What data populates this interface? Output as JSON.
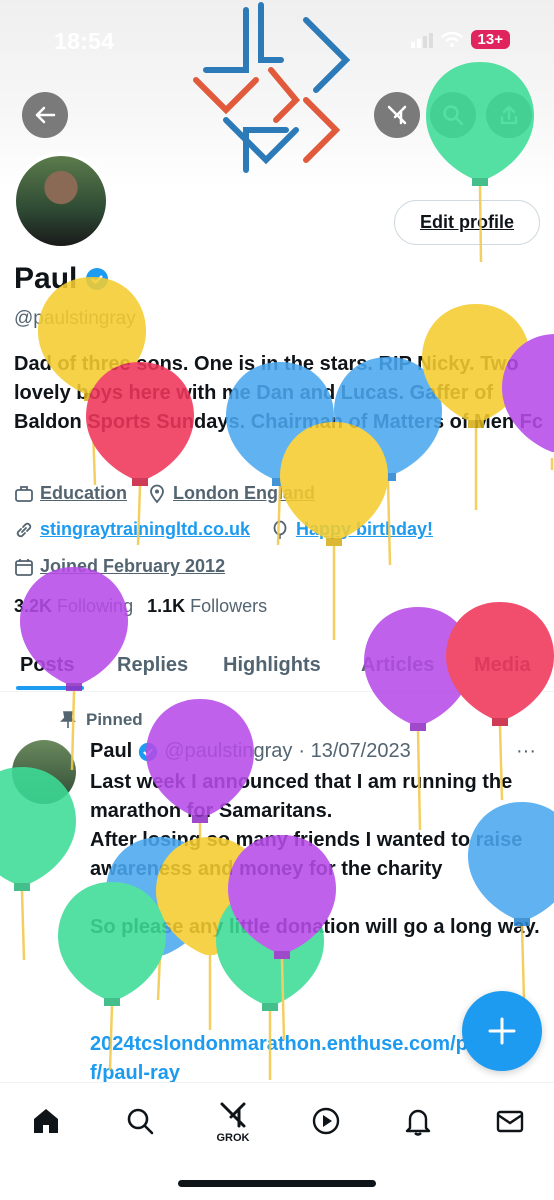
{
  "status_bar": {
    "time": "18:54",
    "battery": "13+"
  },
  "profile": {
    "name": "Paul",
    "handle": "@paulstingray",
    "bio": "Dad of three sons. One is in the stars. RIP Nicky. Two lovely boys here with me Dan and Lucas. Gaffer of Baldon Sports Sundays. Chairman of Matters of Men Fc",
    "category": "Education",
    "location": "London England",
    "website": "stingraytrainingltd.co.uk",
    "birthday": "Happy birthday!",
    "joined": "Joined February 2012",
    "following_count": "3.2K",
    "following_label": "Following",
    "followers_count": "1.1K",
    "followers_label": "Followers",
    "edit_label": "Edit profile"
  },
  "tabs": [
    {
      "label": "Posts"
    },
    {
      "label": "Replies"
    },
    {
      "label": "Highlights"
    },
    {
      "label": "Articles"
    },
    {
      "label": "Media"
    }
  ],
  "post": {
    "pinned_label": "Pinned",
    "author": "Paul",
    "handle": "@paulstingray",
    "date": "· 13/07/2023",
    "text": "Last week I announced that I am running the marathon for Samaritans.\nAfter losing so many friends I wanted to raise awareness and money for the charity\n\nSo please any little donation will go a long way.",
    "link": "2024tcslondonmarathon.enthuse.com/pf/paul-ray"
  },
  "bottom_nav": {
    "grok_label": "GROK"
  },
  "colors": {
    "accent": "#1d9bf0",
    "text": "#0f1419",
    "muted": "#536471"
  },
  "icons": [
    "back-arrow-icon",
    "grok-icon",
    "search-icon",
    "share-icon",
    "verified-badge-icon",
    "briefcase-icon",
    "location-pin-icon",
    "link-icon",
    "balloon-icon",
    "calendar-icon",
    "pin-icon",
    "more-icon",
    "plus-icon",
    "home-icon",
    "play-icon",
    "bell-icon",
    "mail-icon"
  ]
}
